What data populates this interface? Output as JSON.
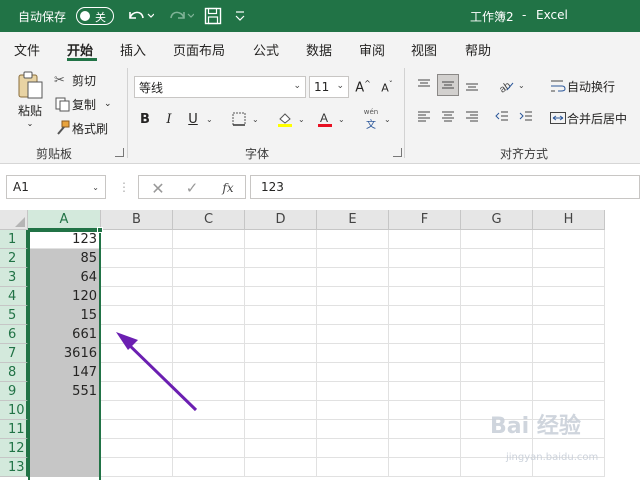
{
  "titlebar": {
    "autosave_label": "自动保存",
    "autosave_state": "关",
    "title": "工作簿2",
    "separator": "-",
    "app": "Excel"
  },
  "tabs": [
    "文件",
    "开始",
    "插入",
    "页面布局",
    "公式",
    "数据",
    "审阅",
    "视图",
    "帮助"
  ],
  "active_tab": "开始",
  "ribbon": {
    "clipboard": {
      "paste": "粘贴",
      "cut": "剪切",
      "copy": "复制",
      "format_painter": "格式刷",
      "group_label": "剪贴板"
    },
    "font": {
      "font_name": "等线",
      "font_size": "11",
      "bold": "B",
      "italic": "I",
      "underline": "U",
      "phonetic_top": "wén",
      "phonetic_bottom": "文",
      "group_label": "字体",
      "fill_color": "#ffff00",
      "font_color": "#e81123"
    },
    "alignment": {
      "wrap_text": "自动换行",
      "merge_center": "合并后居中",
      "group_label": "对齐方式"
    }
  },
  "formula_bar": {
    "name_box": "A1",
    "formula": "123",
    "dots": "⋮"
  },
  "sheet": {
    "columns": [
      "A",
      "B",
      "C",
      "D",
      "E",
      "F",
      "G",
      "H"
    ],
    "rows": [
      "1",
      "2",
      "3",
      "4",
      "5",
      "6",
      "7",
      "8",
      "9",
      "10",
      "11",
      "12",
      "13"
    ],
    "column_a_values": [
      "123",
      "85",
      "64",
      "120",
      "15",
      "661",
      "3616",
      "147",
      "551",
      "",
      "",
      "",
      ""
    ]
  },
  "watermark": {
    "brand": "Bai  经验",
    "url": "jingyan.baidu.com"
  },
  "colors": {
    "brand_green": "#217346",
    "selection_fill": "#c6c6c6",
    "arrow": "#6b1fb1"
  }
}
